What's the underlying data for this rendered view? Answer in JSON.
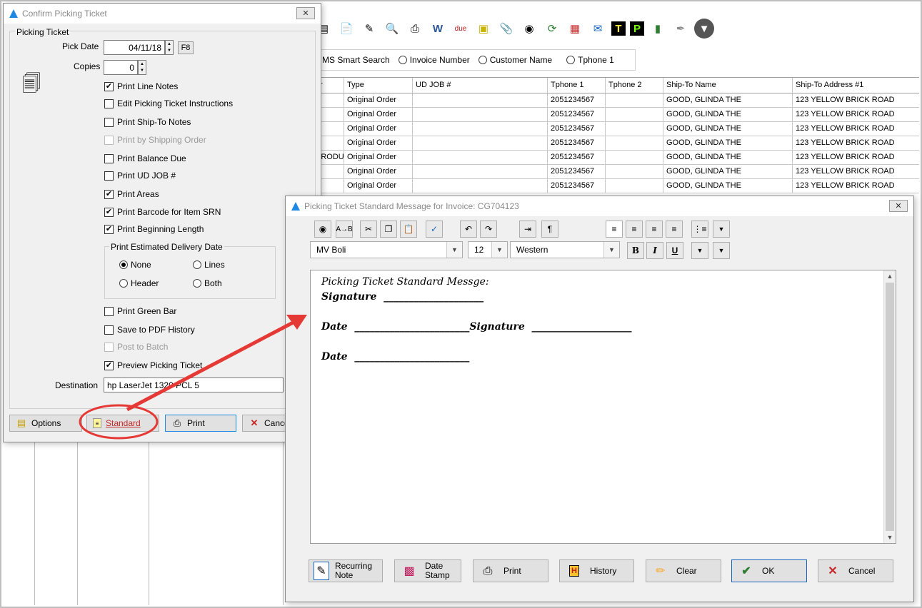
{
  "main_window": {
    "toolbar_icons": [
      "binoculars-icon",
      "document-icon",
      "edit-icon",
      "search-doc-icon",
      "printer-icon",
      "word-icon",
      "due-icon",
      "ticket-icon",
      "paperclip-icon",
      "find-icon",
      "refresh-icon",
      "calendar-icon",
      "email-icon",
      "t-icon",
      "p-icon",
      "book-icon",
      "pen-icon",
      "disk-icon"
    ],
    "search": {
      "label_smart": "MS Smart Search",
      "opt_invoice": "Invoice Number",
      "opt_customer": "Customer Name",
      "opt_tphone": "Tphone 1"
    },
    "grid": {
      "columns": [
        "er",
        "Type",
        "UD JOB #",
        "Tphone 1",
        "Tphone 2",
        "Ship-To Name",
        "Ship-To Address #1"
      ],
      "rows": [
        [
          "",
          "Original Order",
          "",
          "2051234567",
          "",
          "GOOD, GLINDA THE",
          "123 YELLOW BRICK ROAD"
        ],
        [
          "",
          "Original Order",
          "",
          "2051234567",
          "",
          "GOOD, GLINDA THE",
          "123 YELLOW BRICK ROAD"
        ],
        [
          "",
          "Original Order",
          "",
          "2051234567",
          "",
          "GOOD, GLINDA THE",
          "123 YELLOW BRICK ROAD"
        ],
        [
          "",
          "Original Order",
          "",
          "2051234567",
          "",
          "GOOD, GLINDA THE",
          "123 YELLOW BRICK ROAD"
        ],
        [
          "PRODU",
          "Original Order",
          "",
          "2051234567",
          "",
          "GOOD, GLINDA THE",
          "123 YELLOW BRICK ROAD"
        ],
        [
          "",
          "Original Order",
          "",
          "2051234567",
          "",
          "GOOD, GLINDA THE",
          "123 YELLOW BRICK ROAD"
        ],
        [
          "",
          "Original Order",
          "",
          "2051234567",
          "",
          "GOOD, GLINDA THE",
          "123 YELLOW BRICK ROAD"
        ]
      ]
    }
  },
  "confirm_dialog": {
    "title": "Confirm Picking Ticket",
    "group_label": "Picking Ticket",
    "pick_date_label": "Pick Date",
    "pick_date_value": "04/11/18",
    "f8_label": "F8",
    "copies_label": "Copies",
    "copies_value": "0",
    "options": {
      "print_line_notes": "Print Line Notes",
      "edit_instructions": "Edit Picking Ticket Instructions",
      "print_ship_to_notes": "Print Ship-To Notes",
      "print_by_shipping_order": "Print by Shipping Order",
      "print_balance_due": "Print Balance Due",
      "print_ud_job": "Print UD JOB #",
      "print_areas": "Print Areas",
      "print_barcode": "Print Barcode for Item SRN",
      "print_beginning_length": "Print Beginning Length",
      "print_green_bar": "Print Green Bar",
      "save_pdf_history": "Save to PDF History",
      "post_to_batch": "Post to Batch",
      "preview": "Preview Picking Ticket"
    },
    "delivery_group": {
      "label": "Print Estimated Delivery Date",
      "none": "None",
      "lines": "Lines",
      "header": "Header",
      "both": "Both"
    },
    "destination_label": "Destination",
    "destination_value": "hp LaserJet 1320 PCL 5",
    "buttons": {
      "options": "Options",
      "standard": "Standard",
      "print": "Print",
      "cancel": "Cancel"
    }
  },
  "message_dialog": {
    "title": "Picking Ticket Standard Message for Invoice: CG704123",
    "font_name": "MV Boli",
    "font_size": "12",
    "script": "Western",
    "bold": "B",
    "italic": "I",
    "underline": "U",
    "content": {
      "line1": "Picking Ticket Standard Messge:",
      "line2": "Signature  ____________________",
      "line3": "Date  _______________________Signature  ____________________",
      "line4": "Date  _______________________"
    },
    "buttons": {
      "recurring_note": "Recurring\nNote",
      "date_stamp": "Date\nStamp",
      "print": "Print",
      "history": "History",
      "clear": "Clear",
      "ok": "OK",
      "cancel": "Cancel"
    }
  },
  "colors": {
    "annotation_red": "#e53935",
    "ok_border": "#1565c0"
  }
}
